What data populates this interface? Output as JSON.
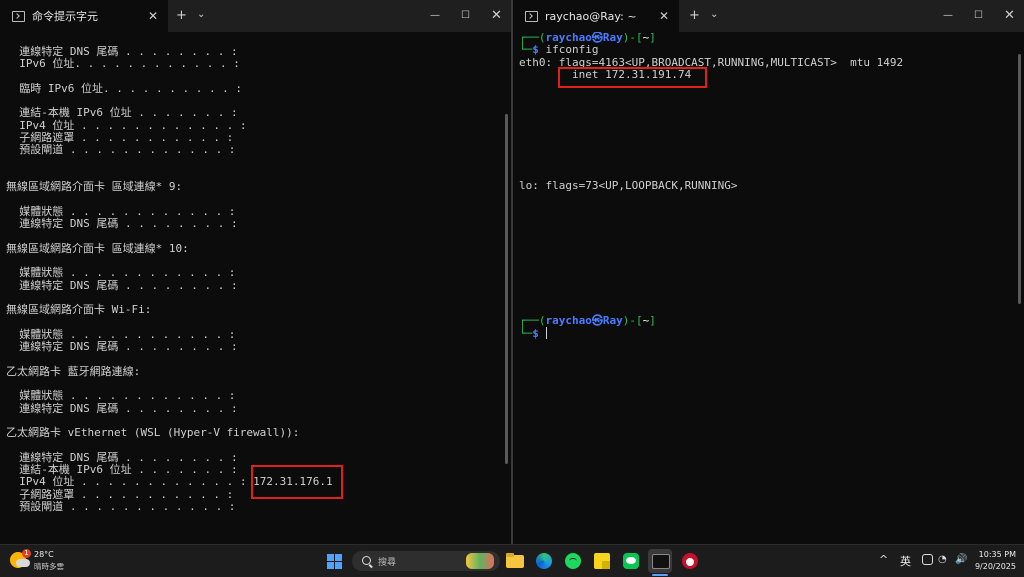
{
  "left_window": {
    "tab_title": "命令提示字元",
    "close_glyph": "✕",
    "new_tab": "+",
    "dropdown": "⌄",
    "minimize": "—",
    "maximize": "☐",
    "close": "✕",
    "lines": [
      "  連線特定 DNS 尾碼 . . . . . . . . :",
      "  IPv6 位址. . . . . . . . . . . . :",
      "",
      "  臨時 IPv6 位址. . . . . . . . . . :",
      "",
      "  連結-本機 IPv6 位址 . . . . . . . :",
      "  IPv4 位址 . . . . . . . . . . . . :",
      "  子網路遮罩 . . . . . . . . . . . :",
      "  預設閘道 . . . . . . . . . . . . :",
      "",
      "",
      "無線區域網路介面卡 區域連線* 9:",
      "",
      "  媒體狀態 . . . . . . . . . . . . :",
      "  連線特定 DNS 尾碼 . . . . . . . . :",
      "",
      "無線區域網路介面卡 區域連線* 10:",
      "",
      "  媒體狀態 . . . . . . . . . . . . :",
      "  連線特定 DNS 尾碼 . . . . . . . . :",
      "",
      "無線區域網路介面卡 Wi-Fi:",
      "",
      "  媒體狀態 . . . . . . . . . . . . :",
      "  連線特定 DNS 尾碼 . . . . . . . . :",
      "",
      "乙太網路卡 藍牙網路連線:",
      "",
      "  媒體狀態 . . . . . . . . . . . . :",
      "  連線特定 DNS 尾碼 . . . . . . . . :",
      "",
      "乙太網路卡 vEthernet (WSL (Hyper-V firewall)):",
      "",
      "  連線特定 DNS 尾碼 . . . . . . . . :",
      "  連結-本機 IPv6 位址 . . . . . . . :",
      "  IPv4 位址 . . . . . . . . . . . . : 172.31.176.1",
      "  子網路遮罩 . . . . . . . . . . . :",
      "  預設閘道 . . . . . . . . . . . . :"
    ]
  },
  "right_window": {
    "tab_title": "raychao@Ray: ~",
    "close_glyph": "✕",
    "new_tab": "+",
    "dropdown": "⌄",
    "minimize": "—",
    "maximize": "☐",
    "close": "✕",
    "prompt_user": "raychao",
    "prompt_sym": "㉿",
    "prompt_host": "Ray",
    "prompt_dir": "~",
    "command": "ifconfig",
    "eth0_line": "eth0: flags=4163<UP,BROADCAST,RUNNING,MULTICAST>  mtu 1492",
    "inet_line": "        inet 172.31.191.74",
    "lo_line": "lo: flags=73<UP,LOOPBACK,RUNNING>"
  },
  "taskbar": {
    "weather_temp": "28°C",
    "weather_cond": "晴時多雲",
    "weather_badge": "1",
    "search_placeholder": "搜尋",
    "tray_chevron": "^",
    "ime": "英",
    "wifi": "◔",
    "volume": "🔊",
    "time": "10:35 PM",
    "date": "9/20/2025"
  },
  "colors": {
    "highlight": "#e0201c",
    "prompt_green": "#2fbf4f",
    "prompt_blue": "#4a7dff",
    "accent": "#5aa0ff"
  }
}
